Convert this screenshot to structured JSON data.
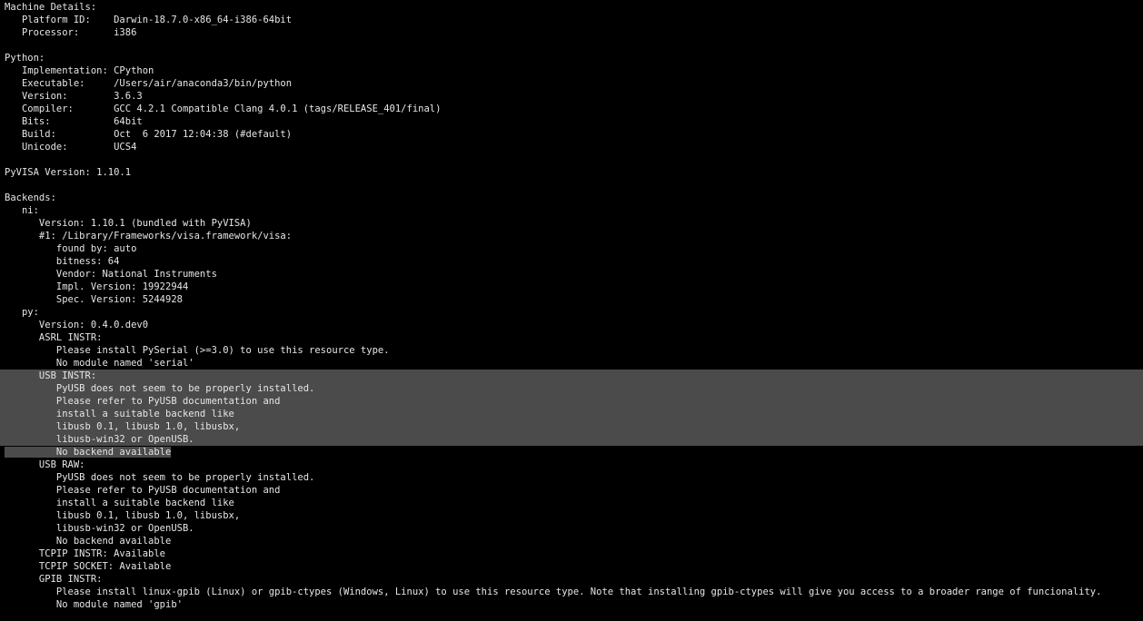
{
  "terminal": {
    "background": "#000000",
    "text_color": "#e6e6e6",
    "selection_color": "#4b4b4b",
    "lines": [
      {
        "text": "Machine Details:"
      },
      {
        "text": "   Platform ID:    Darwin-18.7.0-x86_64-i386-64bit"
      },
      {
        "text": "   Processor:      i386"
      },
      {
        "text": ""
      },
      {
        "text": "Python:"
      },
      {
        "text": "   Implementation: CPython"
      },
      {
        "text": "   Executable:     /Users/air/anaconda3/bin/python"
      },
      {
        "text": "   Version:        3.6.3"
      },
      {
        "text": "   Compiler:       GCC 4.2.1 Compatible Clang 4.0.1 (tags/RELEASE_401/final)"
      },
      {
        "text": "   Bits:           64bit"
      },
      {
        "text": "   Build:          Oct  6 2017 12:04:38 (#default)"
      },
      {
        "text": "   Unicode:        UCS4"
      },
      {
        "text": ""
      },
      {
        "text": "PyVISA Version: 1.10.1"
      },
      {
        "text": ""
      },
      {
        "text": "Backends:"
      },
      {
        "text": "   ni:"
      },
      {
        "text": "      Version: 1.10.1 (bundled with PyVISA)"
      },
      {
        "text": "      #1: /Library/Frameworks/visa.framework/visa:"
      },
      {
        "text": "         found by: auto"
      },
      {
        "text": "         bitness: 64"
      },
      {
        "text": "         Vendor: National Instruments"
      },
      {
        "text": "         Impl. Version: 19922944"
      },
      {
        "text": "         Spec. Version: 5244928"
      },
      {
        "text": "   py:"
      },
      {
        "text": "      Version: 0.4.0.dev0"
      },
      {
        "text": "      ASRL INSTR:"
      },
      {
        "text": "         Please install PySerial (>=3.0) to use this resource type."
      },
      {
        "text": "         No module named 'serial'"
      },
      {
        "text": "      USB INSTR:",
        "selected": true
      },
      {
        "text": "         PyUSB does not seem to be properly installed.",
        "selected": true
      },
      {
        "text": "         Please refer to PyUSB documentation and",
        "selected": true
      },
      {
        "text": "         install a suitable backend like",
        "selected": true
      },
      {
        "text": "         libusb 0.1, libusb 1.0, libusbx,",
        "selected": true
      },
      {
        "text": "         libusb-win32 or OpenUSB.",
        "selected": true
      },
      {
        "text": "         No backend available",
        "selected_partial": true
      },
      {
        "text": "      USB RAW:"
      },
      {
        "text": "         PyUSB does not seem to be properly installed."
      },
      {
        "text": "         Please refer to PyUSB documentation and"
      },
      {
        "text": "         install a suitable backend like"
      },
      {
        "text": "         libusb 0.1, libusb 1.0, libusbx,"
      },
      {
        "text": "         libusb-win32 or OpenUSB."
      },
      {
        "text": "         No backend available"
      },
      {
        "text": "      TCPIP INSTR: Available"
      },
      {
        "text": "      TCPIP SOCKET: Available"
      },
      {
        "text": "      GPIB INSTR:"
      },
      {
        "text": "         Please install linux-gpib (Linux) or gpib-ctypes (Windows, Linux) to use this resource type. Note that installing gpib-ctypes will give you access to a broader range of funcionality."
      },
      {
        "text": "         No module named 'gpib'"
      }
    ]
  }
}
